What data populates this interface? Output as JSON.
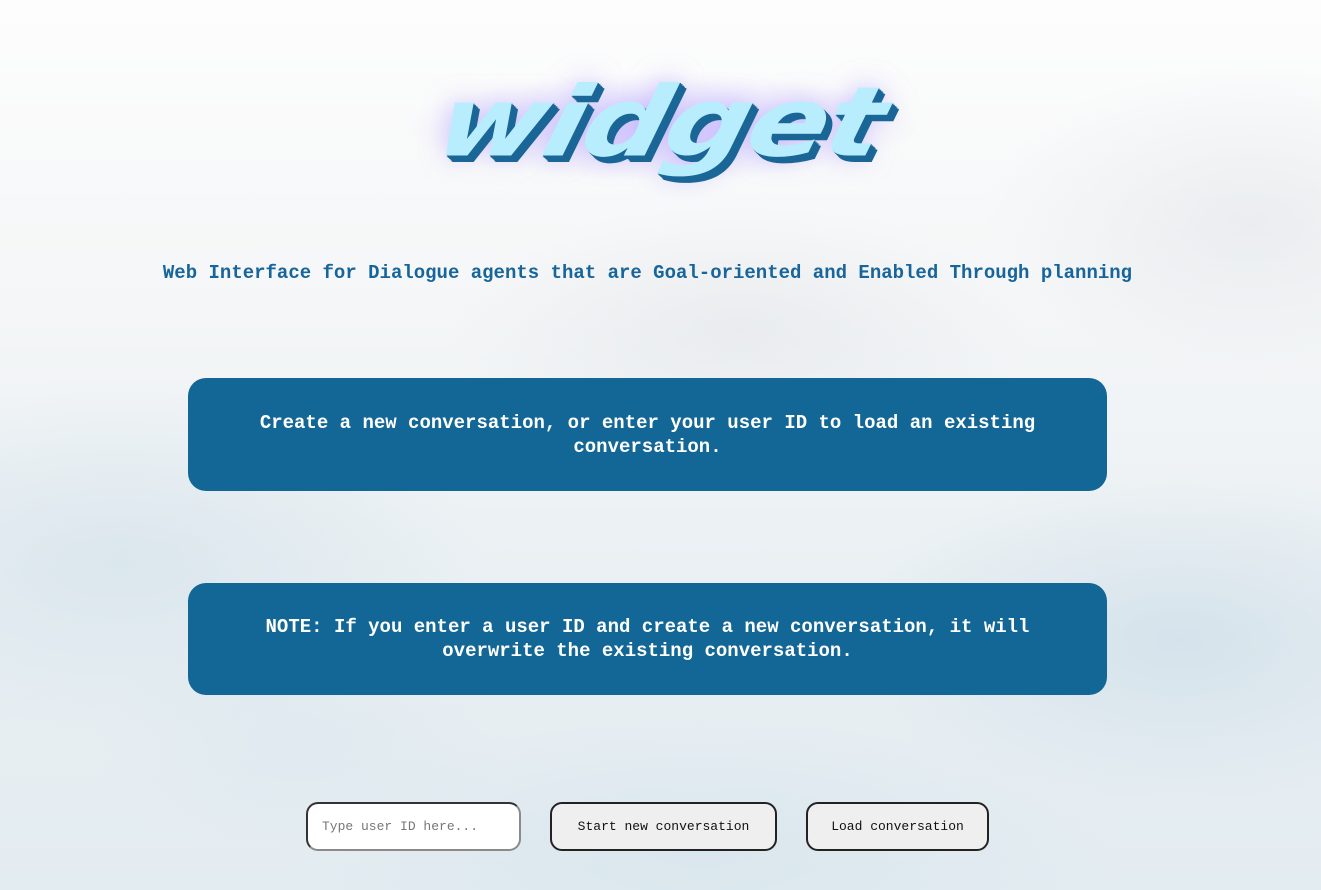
{
  "header": {
    "logo_text": "widget",
    "subtitle": "Web Interface for Dialogue agents that are Goal-oriented and Enabled Through planning"
  },
  "panels": {
    "info": "Create a new conversation, or enter your user ID to load an existing conversation.",
    "note": "NOTE: If you enter a user ID and create a new conversation, it will overwrite the existing conversation."
  },
  "controls": {
    "user_id_placeholder": "Type user ID here...",
    "user_id_value": "",
    "start_button_label": "Start new conversation",
    "load_button_label": "Load conversation"
  },
  "colors": {
    "primary": "#136796",
    "logo_fill": "#b8edfd",
    "logo_shadow": "#1a6696",
    "subtitle_text": "#17659a",
    "button_bg": "#efefef"
  }
}
